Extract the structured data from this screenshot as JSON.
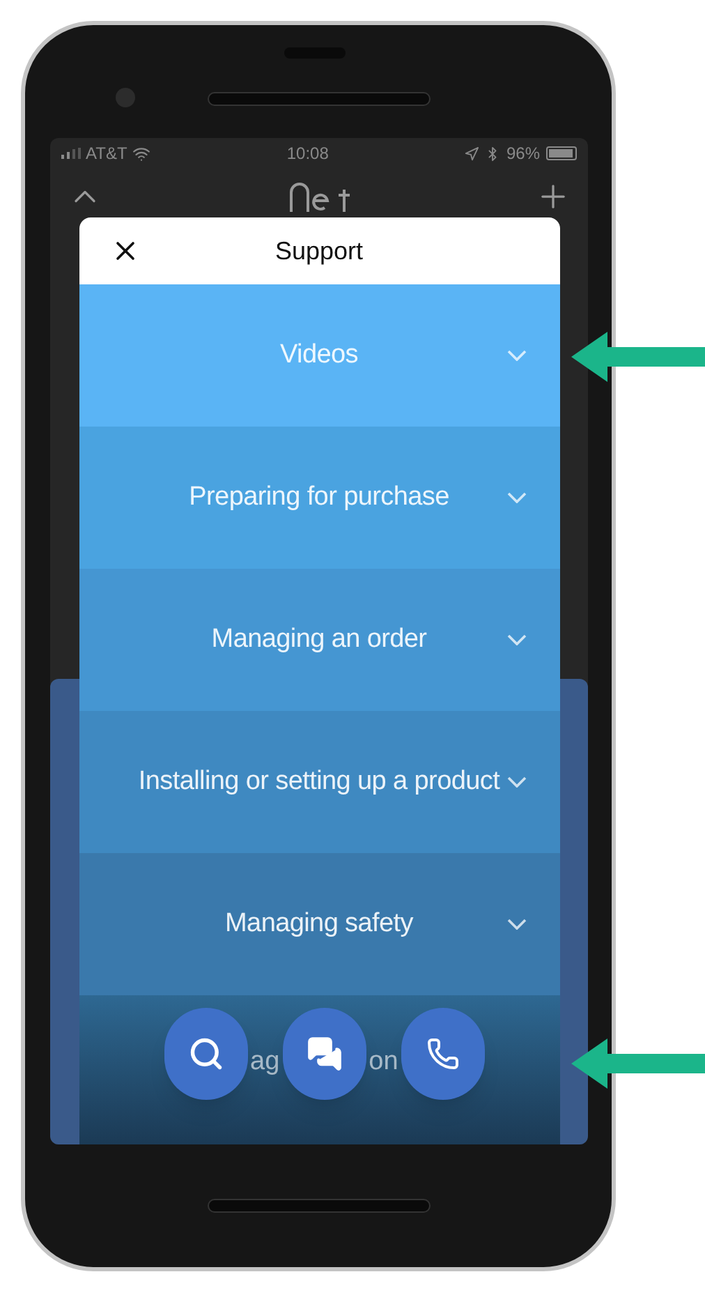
{
  "status_bar": {
    "carrier": "AT&T",
    "time": "10:08",
    "battery": "96%"
  },
  "modal": {
    "title": "Support"
  },
  "rows": [
    {
      "label": "Videos",
      "expanded": false
    },
    {
      "label": "Preparing for purchase",
      "expanded": false
    },
    {
      "label": "Managing an order",
      "expanded": false
    },
    {
      "label": "Installing or setting up a product",
      "expanded": false
    },
    {
      "label": "Managing safety",
      "expanded": false
    }
  ],
  "partial_row": {
    "fragments": [
      "ag",
      "on"
    ]
  }
}
